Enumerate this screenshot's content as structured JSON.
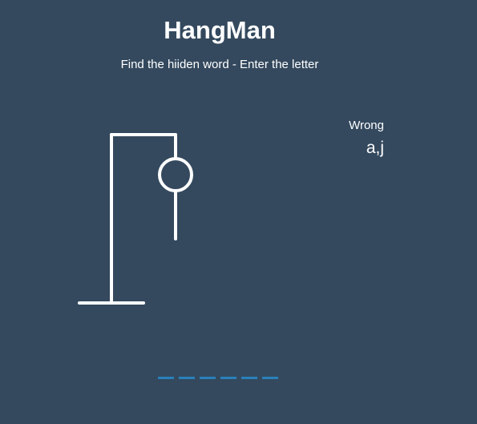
{
  "header": {
    "title": "HangMan",
    "subtitle": "Find the hiiden word - Enter the letter"
  },
  "wrong": {
    "label": "Wrong",
    "letters": "a,j"
  },
  "game": {
    "parts_drawn": [
      "head",
      "body"
    ],
    "word_slots": [
      "",
      "",
      "",
      "",
      "",
      ""
    ]
  },
  "colors": {
    "background": "#34495e",
    "figure": "#ffffff",
    "word_underline": "#2980b9"
  }
}
